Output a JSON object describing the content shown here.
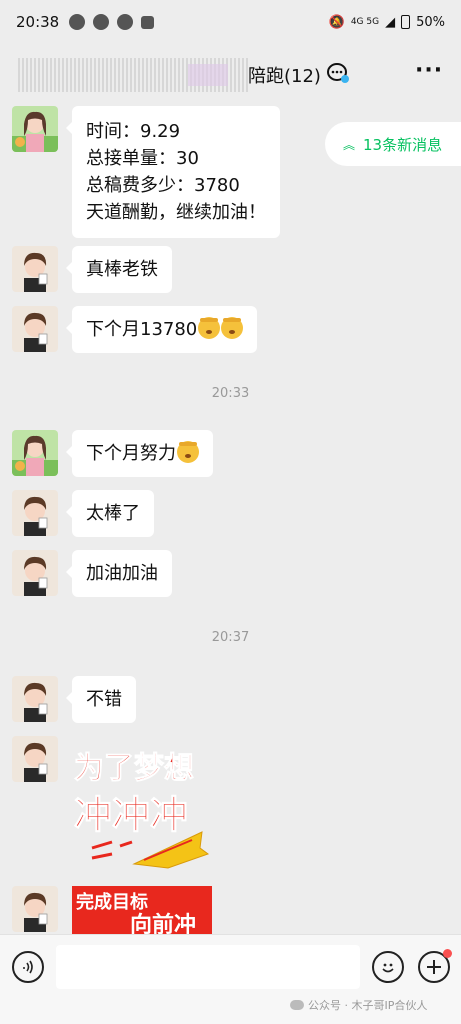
{
  "status_bar": {
    "time": "20:38",
    "battery": "50%",
    "network": "4G 5G"
  },
  "header": {
    "title": "陪跑(12)"
  },
  "new_messages": {
    "label": "13条新消息"
  },
  "messages": [
    {
      "lines": [
        "时间：9.29",
        "总接单量：30",
        "总稿费多少：3780",
        "天道酬勤，继续加油！"
      ]
    },
    {
      "text": "真棒老铁"
    },
    {
      "text": "下个月13780"
    },
    {
      "text": "下个月努力"
    },
    {
      "text": "太棒了"
    },
    {
      "text": "加油加油"
    },
    {
      "text": "不错"
    }
  ],
  "timestamps": [
    "20:33",
    "20:37"
  ],
  "stickers": [
    {
      "line1": "为了梦想",
      "line2": "冲冲冲"
    },
    {
      "line1": "完成目标",
      "line2": "向前冲"
    }
  ],
  "watermark": "公众号 · 木子哥IP合伙人",
  "colors": {
    "accent": "#07c160",
    "bubble": "#ffffff",
    "background": "#ededed",
    "sticker_red": "#e8281e"
  }
}
